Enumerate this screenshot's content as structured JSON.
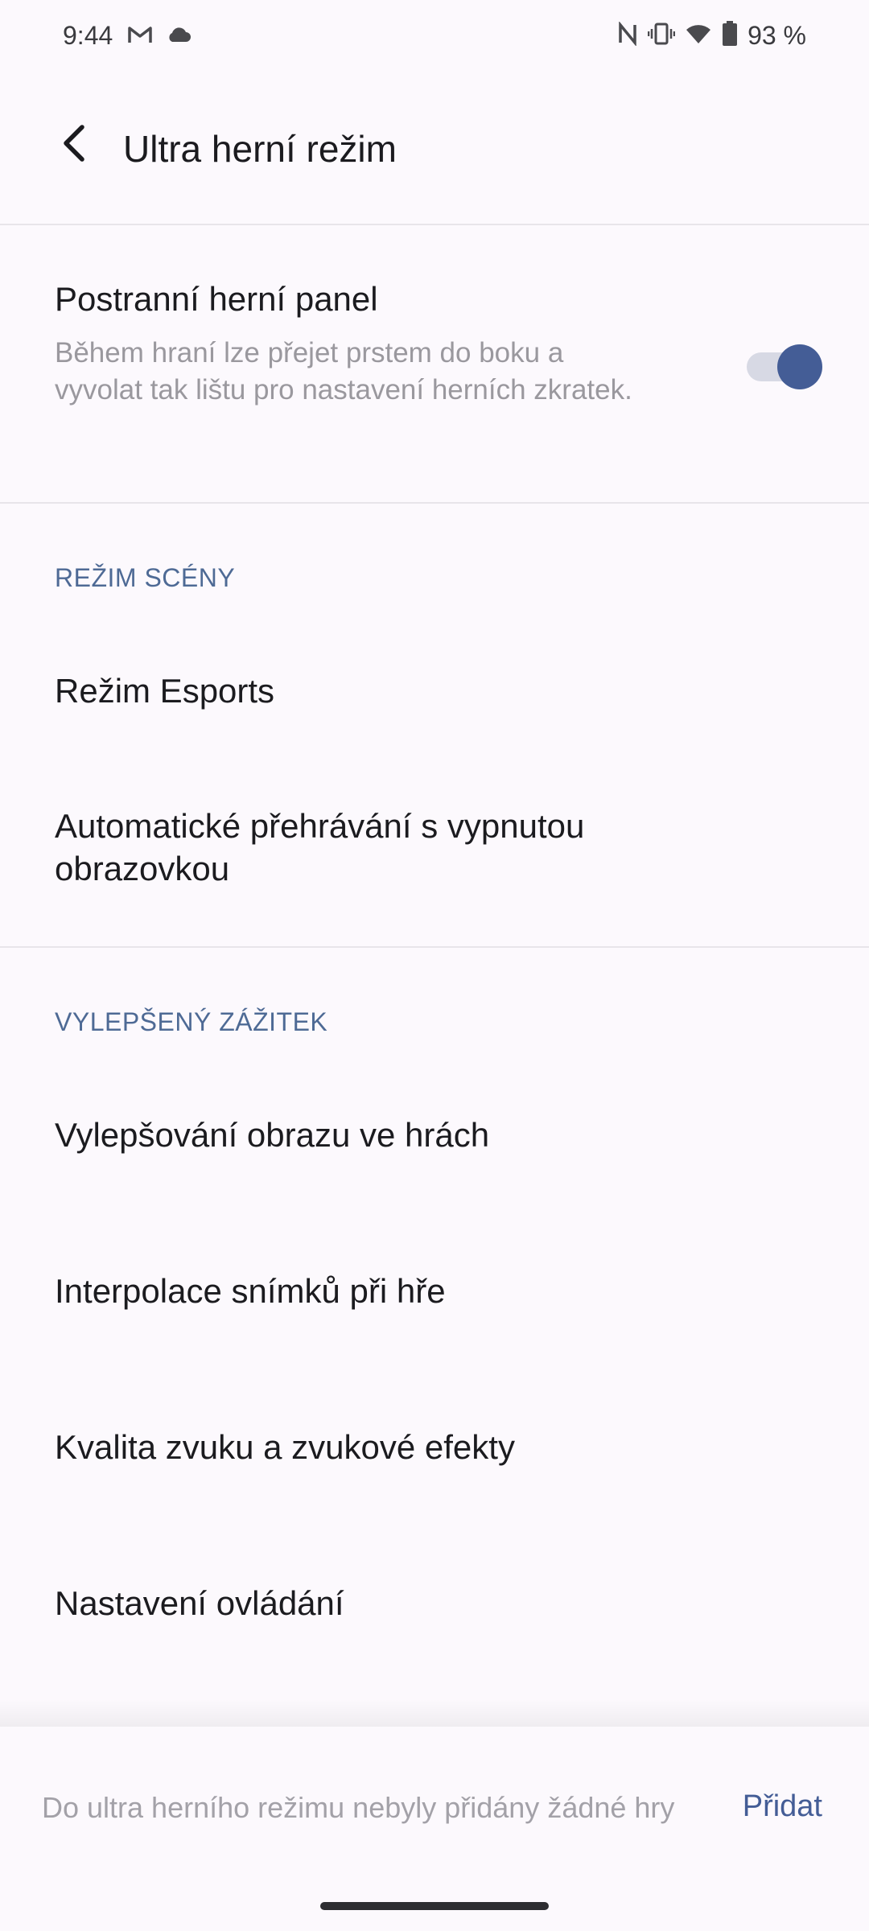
{
  "status_bar": {
    "time": "9:44",
    "left_icons": [
      "gmail-icon",
      "cloud-icon"
    ],
    "right_icons": [
      "nfc-icon",
      "vibrate-icon",
      "wifi-icon",
      "battery-icon"
    ],
    "battery": "93 %"
  },
  "header": {
    "title": "Ultra herní režim",
    "back_icon": "back-arrow-icon"
  },
  "side_panel": {
    "title": "Postranní herní panel",
    "description": "Během hraní lze přejet prstem do boku a vyvolat tak lištu pro nastavení herních zkratek.",
    "toggle_on": true
  },
  "scene_mode": {
    "header": "REŽIM SCÉNY",
    "items": [
      {
        "label": "Režim Esports"
      },
      {
        "label": "Automatické přehrávání s vypnutou obrazovkou"
      }
    ]
  },
  "enhanced": {
    "header": "VYLEPŠENÝ ZÁŽITEK",
    "items": [
      {
        "label": "Vylepšování obrazu ve hrách"
      },
      {
        "label": "Interpolace snímků při hře"
      },
      {
        "label": "Kvalita zvuku a zvukové efekty"
      },
      {
        "label": "Nastavení ovládání"
      }
    ]
  },
  "bottom_bar": {
    "message": "Do ultra herního režimu nebyly přidány žádné hry",
    "add_label": "Přidat"
  },
  "colors": {
    "background": "#fcf9fd",
    "accent": "#445d96",
    "section_header": "#4e6a95",
    "secondary_text": "#9a989e"
  }
}
